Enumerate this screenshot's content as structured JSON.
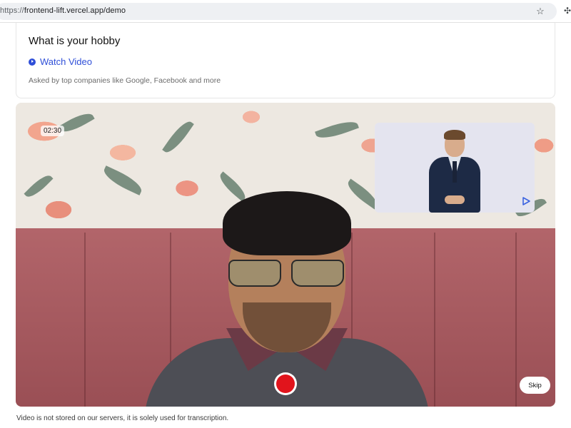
{
  "browser": {
    "url_scheme": "https://",
    "url_host_path": "frontend-lift.vercel.app/demo",
    "star_icon": "star-icon",
    "extension_icon": "puzzle-icon"
  },
  "question": {
    "title": "What is your hobby",
    "watch_label": "Watch Video",
    "watch_icon": "play-circle-icon",
    "asked_text": "Asked by top companies like Google, Facebook and more",
    "link_color": "#2f4fd8"
  },
  "recorder": {
    "timer": "02:30",
    "skip_label": "Skip",
    "record_color": "#e1141c",
    "pip_play_icon": "play-outline-icon"
  },
  "footer": {
    "disclaimer": "Video is not stored on our servers, it is solely used for transcription."
  }
}
